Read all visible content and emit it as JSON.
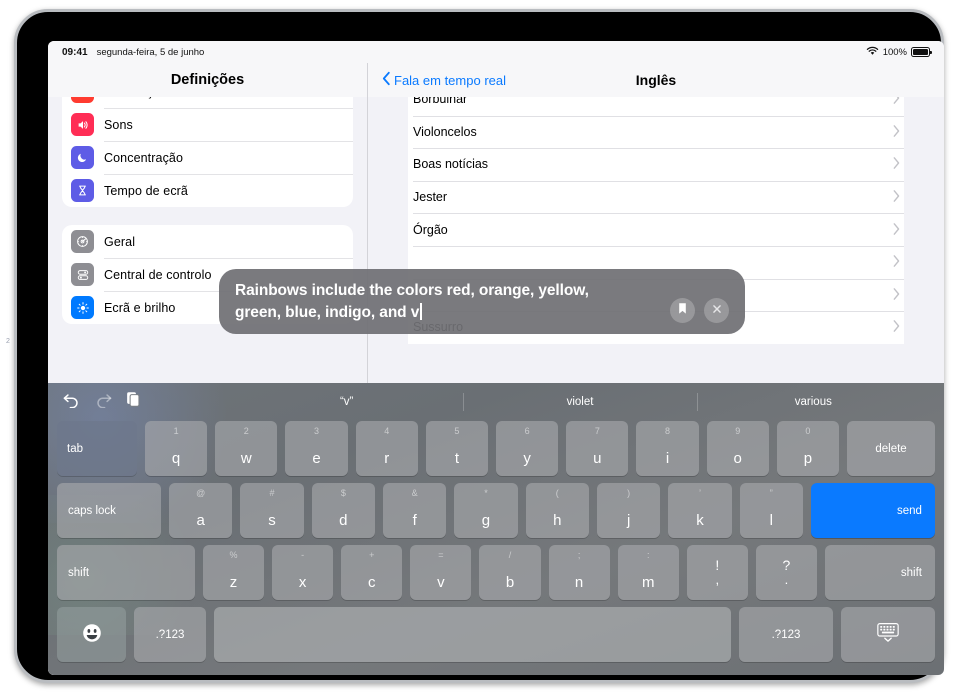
{
  "status_bar": {
    "time": "09:41",
    "date": "segunda-feira, 5 de junho",
    "battery_percent": "100%",
    "wifi_icon": "wifi-icon",
    "battery_icon": "battery-full-icon"
  },
  "sidebar": {
    "title": "Definições",
    "groups": [
      {
        "items": [
          {
            "label": "Notificações",
            "icon": "notifications-icon",
            "icon_color": "#ff3b30",
            "glyph": "▢"
          },
          {
            "label": "Sons",
            "icon": "sound-icon",
            "icon_color": "#ff2d55",
            "glyph": "🔊"
          },
          {
            "label": "Concentração",
            "icon": "focus-moon-icon",
            "icon_color": "#5e5ce6",
            "glyph": "☽"
          },
          {
            "label": "Tempo de ecrã",
            "icon": "screen-time-hourglass-icon",
            "icon_color": "#5e5ce6",
            "glyph": "⌛"
          }
        ]
      },
      {
        "items": [
          {
            "label": "Geral",
            "icon": "general-gear-icon",
            "icon_color": "#8e8e93",
            "glyph": "⚙"
          },
          {
            "label": "Central de controlo",
            "icon": "control-center-sliders-icon",
            "icon_color": "#8e8e93",
            "glyph": "☰"
          },
          {
            "label": "Ecrã e brilho",
            "icon": "display-brightness-icon",
            "icon_color": "#007aff",
            "glyph": "☀"
          }
        ]
      }
    ]
  },
  "detail": {
    "back_label": "Fala em tempo real",
    "back_icon": "chevron-left-icon",
    "title": "Inglês",
    "rows": [
      {
        "label": "Borbulhar",
        "chevron": "chevron-right-icon"
      },
      {
        "label": "Violoncelos",
        "chevron": "chevron-right-icon"
      },
      {
        "label": "Boas notícias",
        "chevron": "chevron-right-icon"
      },
      {
        "label": "Jester",
        "chevron": "chevron-right-icon"
      },
      {
        "label": "Órgão",
        "chevron": "chevron-right-icon"
      },
      {
        "label": "",
        "chevron": "chevron-right-icon"
      },
      {
        "label": "",
        "chevron": "chevron-right-icon"
      },
      {
        "label": "Sussurro",
        "chevron": "chevron-right-icon"
      }
    ]
  },
  "speech_bubble": {
    "text": "Rainbows include the colors red, orange, yellow, green, blue, indigo, and v",
    "has_caret": true,
    "bookmark_icon": "bookmark-icon",
    "close_icon": "close-x-icon",
    "background_color": "#707074"
  },
  "keyboard": {
    "toolbar": {
      "undo_icon": "undo-arrow-icon",
      "redo_icon": "redo-arrow-icon",
      "paste_icon": "paste-clipboard-icon"
    },
    "predictions": [
      "“v”",
      "violet",
      "various"
    ],
    "rows": [
      {
        "name": "row-1",
        "keys": [
          {
            "label": "tab",
            "type": "tab",
            "name": "key-tab"
          },
          {
            "label": "q",
            "alt": "1",
            "type": "letter",
            "name": "key-q"
          },
          {
            "label": "w",
            "alt": "2",
            "type": "letter",
            "name": "key-w"
          },
          {
            "label": "e",
            "alt": "3",
            "type": "letter",
            "name": "key-e"
          },
          {
            "label": "r",
            "alt": "4",
            "type": "letter",
            "name": "key-r"
          },
          {
            "label": "t",
            "alt": "5",
            "type": "letter",
            "name": "key-t"
          },
          {
            "label": "y",
            "alt": "6",
            "type": "letter",
            "name": "key-y"
          },
          {
            "label": "u",
            "alt": "7",
            "type": "letter",
            "name": "key-u"
          },
          {
            "label": "i",
            "alt": "8",
            "type": "letter",
            "name": "key-i"
          },
          {
            "label": "o",
            "alt": "9",
            "type": "letter",
            "name": "key-o"
          },
          {
            "label": "p",
            "alt": "0",
            "type": "letter",
            "name": "key-p"
          },
          {
            "label": "delete",
            "type": "delete",
            "name": "key-delete"
          }
        ]
      },
      {
        "name": "row-2",
        "keys": [
          {
            "label": "caps lock",
            "type": "caps",
            "name": "key-caps-lock"
          },
          {
            "label": "a",
            "alt": "@",
            "type": "letter",
            "name": "key-a"
          },
          {
            "label": "s",
            "alt": "#",
            "type": "letter",
            "name": "key-s"
          },
          {
            "label": "d",
            "alt": "$",
            "type": "letter",
            "name": "key-d"
          },
          {
            "label": "f",
            "alt": "&",
            "type": "letter",
            "name": "key-f"
          },
          {
            "label": "g",
            "alt": "*",
            "type": "letter",
            "name": "key-g"
          },
          {
            "label": "h",
            "alt": "(",
            "type": "letter",
            "name": "key-h"
          },
          {
            "label": "j",
            "alt": ")",
            "type": "letter",
            "name": "key-j"
          },
          {
            "label": "k",
            "alt": "’",
            "type": "letter",
            "name": "key-k"
          },
          {
            "label": "l",
            "alt": "”",
            "type": "letter",
            "name": "key-l"
          },
          {
            "label": "send",
            "type": "send",
            "name": "key-send"
          }
        ]
      },
      {
        "name": "row-3",
        "keys": [
          {
            "label": "shift",
            "type": "shiftL",
            "name": "key-shift-left"
          },
          {
            "label": "z",
            "alt": "%",
            "type": "letter",
            "name": "key-z"
          },
          {
            "label": "x",
            "alt": "-",
            "type": "letter",
            "name": "key-x"
          },
          {
            "label": "c",
            "alt": "+",
            "type": "letter",
            "name": "key-c"
          },
          {
            "label": "v",
            "alt": "=",
            "type": "letter",
            "name": "key-v"
          },
          {
            "label": "b",
            "alt": "/",
            "type": "letter",
            "name": "key-b"
          },
          {
            "label": "n",
            "alt": ";",
            "type": "letter",
            "name": "key-n"
          },
          {
            "label": "m",
            "alt": ":",
            "type": "letter",
            "name": "key-m"
          },
          {
            "label": "!",
            "bottom": ",",
            "type": "dualsym",
            "name": "key-exclam-comma"
          },
          {
            "label": "?",
            "bottom": ".",
            "type": "dualsym",
            "name": "key-question-period"
          },
          {
            "label": "shift",
            "type": "shiftR",
            "name": "key-shift-right"
          }
        ]
      },
      {
        "name": "row-4",
        "keys": [
          {
            "label": "",
            "type": "emoji",
            "icon": "emoji-smiley-icon",
            "name": "key-emoji"
          },
          {
            "label": ".?123",
            "type": "num",
            "name": "key-numbers-left"
          },
          {
            "label": "",
            "type": "space",
            "name": "key-spacebar"
          },
          {
            "label": ".?123",
            "type": "num2",
            "name": "key-numbers-right"
          },
          {
            "label": "",
            "type": "kbdown",
            "icon": "keyboard-dismiss-icon",
            "name": "key-dismiss-keyboard"
          }
        ]
      }
    ]
  },
  "colors": {
    "accent_blue": "#0a7aff",
    "keyboard_bg": "#6e7479",
    "key_bg": "#a8aaac",
    "bubble_bg": "#707074"
  }
}
